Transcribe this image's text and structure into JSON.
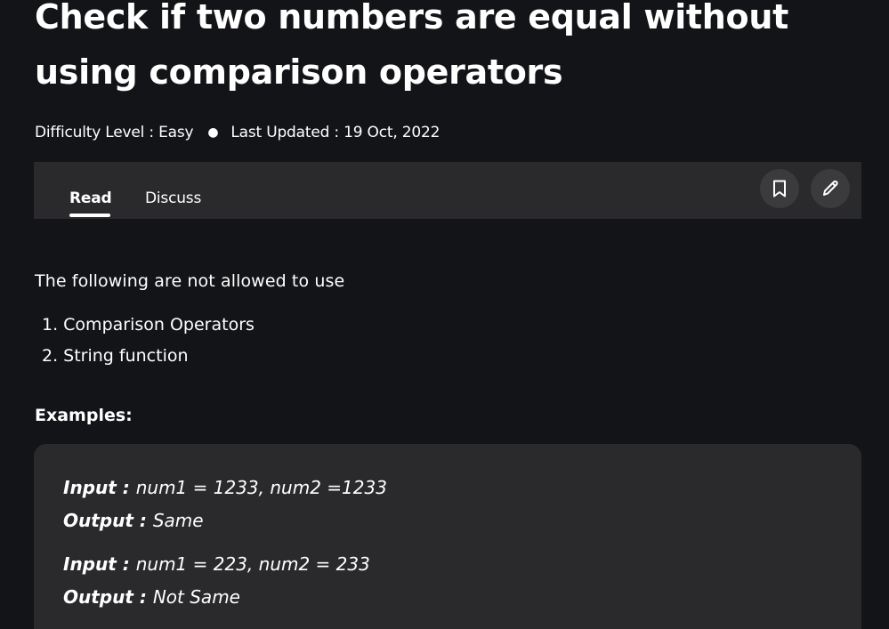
{
  "article": {
    "title": "Check if two numbers are equal without using comparison operators",
    "difficulty_label": "Difficulty Level : ",
    "difficulty_value": "Easy",
    "updated_label": "Last Updated : ",
    "updated_value": "19 Oct, 2022",
    "meta_separator": "●"
  },
  "tabs": {
    "read": "Read",
    "discuss": "Discuss",
    "active": "Read"
  },
  "actions": {
    "bookmark_icon": "bookmark-icon",
    "edit_icon": "pencil-icon"
  },
  "content": {
    "intro": "The following are not allowed to use",
    "rules": [
      "1. Comparison Operators",
      "2. String function"
    ],
    "examples_heading": "Examples:",
    "examples": [
      {
        "input_label": "Input : ",
        "input_value": "num1 = 1233, num2 =1233",
        "output_label": "Output : ",
        "output_value": "Same"
      },
      {
        "input_label": "Input : ",
        "input_value": "num1 = 223, num2 = 233",
        "output_label": "Output : ",
        "output_value": "Not Same"
      }
    ]
  },
  "colors": {
    "background": "#131417",
    "panel": "#2a2a2d",
    "icon_button": "#3b3b3e",
    "text": "#ffffff"
  }
}
